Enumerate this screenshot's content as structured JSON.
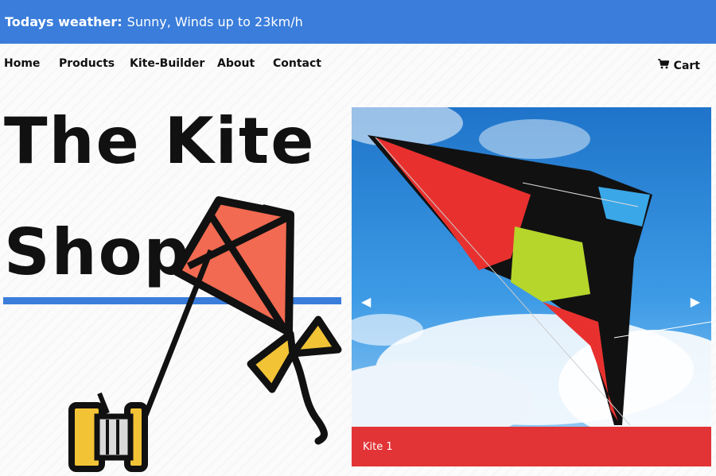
{
  "weather": {
    "label": "Todays weather:",
    "value": "Sunny, Winds up to 23km/h"
  },
  "nav": {
    "items": [
      "Home",
      "Products",
      "Kite-Builder",
      "About",
      "Contact"
    ],
    "cart_label": "Cart"
  },
  "hero": {
    "title_line1": "The Kite",
    "title_line2": "Shop"
  },
  "carousel": {
    "caption": "Kite 1"
  },
  "colors": {
    "accent": "#3a7ddb",
    "caption": "#e23436",
    "kite": "#f26a51"
  },
  "icons": [
    "cart-icon",
    "kite-icon",
    "reel-icon",
    "chevron-left-icon",
    "chevron-right-icon"
  ]
}
